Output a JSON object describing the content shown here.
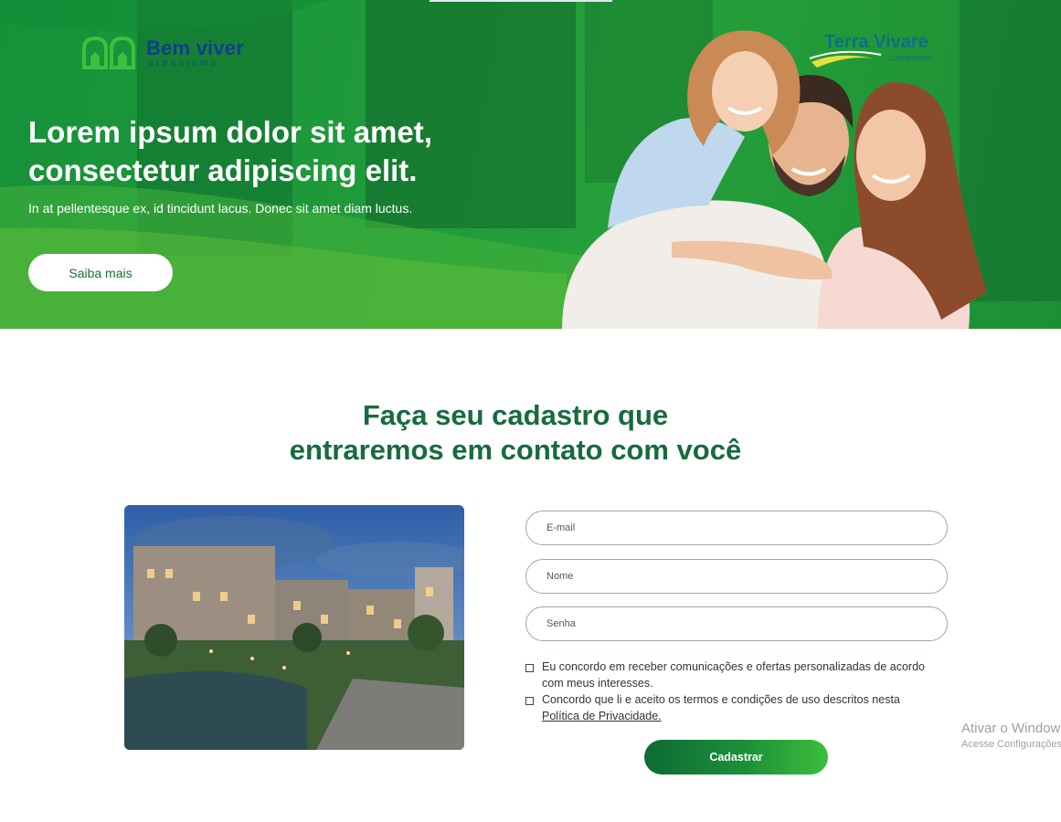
{
  "hero": {
    "logo_left": {
      "brand": "Bem viver",
      "sub": "urbanismo"
    },
    "logo_right": {
      "brand": "Terra Vivare",
      "sub": "Loteamento"
    },
    "title_line1": "Lorem ipsum dolor sit amet,",
    "title_line2": "consectetur adipiscing elit.",
    "subtitle": "In at pellentesque ex, id tincidunt lacus. Donec sit amet diam luctus.",
    "cta_label": "Saiba mais"
  },
  "form_section": {
    "title_line1": "Faça seu cadastro que",
    "title_line2": "entraremos em contato com você",
    "email_placeholder": "E-mail",
    "name_placeholder": "Nome",
    "password_placeholder": "Senha",
    "consent_offers": "Eu concordo em receber comunicações e ofertas personalizadas de acordo com meus interesses.",
    "consent_terms": "Concordo que li e aceito os termos e condições de uso descritos nesta",
    "privacy_link": "Política de Privacidade.",
    "submit_label": "Cadastrar"
  },
  "os_watermark": {
    "line1": "Ativar o Windows",
    "line2": "Acesse Configurações"
  },
  "colors": {
    "hero_green": "#1f9a3a",
    "title_green": "#176b3e",
    "button_green": "#1d8f3a",
    "logo_blue": "#123f8a"
  }
}
